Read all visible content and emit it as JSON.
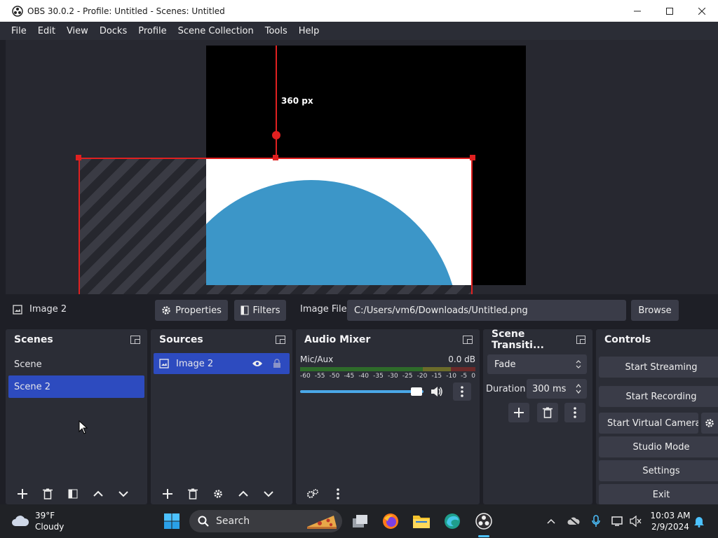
{
  "window": {
    "title": "OBS 30.0.2 - Profile: Untitled - Scenes: Untitled"
  },
  "menu": [
    "File",
    "Edit",
    "View",
    "Docks",
    "Profile",
    "Scene Collection",
    "Tools",
    "Help"
  ],
  "preview": {
    "guide_label": "360 px",
    "colors": {
      "selection": "#e02020",
      "image_fill": "#3c96c8"
    }
  },
  "source_toolbar": {
    "source_name": "Image 2",
    "properties_label": "Properties",
    "filters_label": "Filters",
    "file_label": "Image File",
    "file_path": "C:/Users/vm6/Downloads/Untitled.png",
    "browse_label": "Browse"
  },
  "scenes": {
    "title": "Scenes",
    "items": [
      "Scene",
      "Scene 2"
    ],
    "selected": "Scene 2"
  },
  "sources": {
    "title": "Sources",
    "items": [
      "Image 2"
    ]
  },
  "audio_mixer": {
    "title": "Audio Mixer",
    "channel": "Mic/Aux",
    "level": "0.0 dB",
    "ticks": [
      "-60",
      "-55",
      "-50",
      "-45",
      "-40",
      "-35",
      "-30",
      "-25",
      "-20",
      "-15",
      "-10",
      "-5",
      "0"
    ],
    "volume_fraction": 0.98
  },
  "transitions": {
    "title": "Scene Transiti...",
    "selected": "Fade",
    "duration_label": "Duration",
    "duration_value": "300 ms"
  },
  "controls": {
    "title": "Controls",
    "start_streaming": "Start Streaming",
    "start_recording": "Start Recording",
    "start_virtual_camera": "Start Virtual Camera",
    "studio_mode": "Studio Mode",
    "settings": "Settings",
    "exit": "Exit"
  },
  "taskbar": {
    "temperature": "39°F",
    "weather": "Cloudy",
    "search_placeholder": "Search",
    "time": "10:03 AM",
    "date": "2/9/2024"
  }
}
